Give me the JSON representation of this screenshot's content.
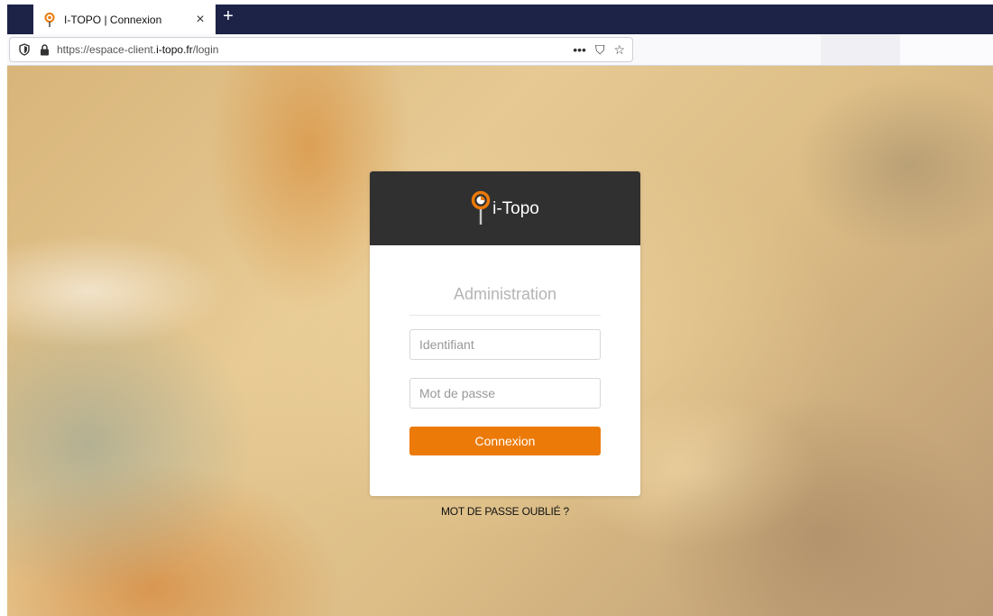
{
  "browser": {
    "tab_title": "I-TOPO | Connexion",
    "tab_close": "×",
    "new_tab": "+",
    "url_prefix": "https://espace-client.",
    "url_domain": "i-topo.fr",
    "url_path": "/login",
    "icons": [
      "site-info-icon",
      "lock-icon",
      "more-icon",
      "pocket-icon",
      "bookmark-star-icon"
    ],
    "more_glyph": "•••",
    "pocket_glyph": "⛉",
    "star_glyph": "☆"
  },
  "login": {
    "brand": "i-Topo",
    "title": "Administration",
    "username_placeholder": "Identifiant",
    "username_value": "",
    "password_placeholder": "Mot de passe",
    "password_value": "",
    "submit_label": "Connexion",
    "forgot_label": "MOT DE PASSE OUBLIÉ ?"
  },
  "colors": {
    "accent": "#ec7a08",
    "header_bg": "#303030",
    "tabbar_bg": "#1d2347"
  }
}
